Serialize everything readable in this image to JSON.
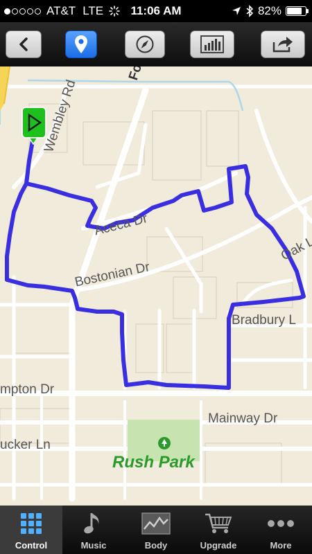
{
  "status_bar": {
    "carrier": "AT&T",
    "network": "LTE",
    "time": "11:06 AM",
    "battery": "82%",
    "battery_level": 0.82
  },
  "toolbar": {
    "buttons": [
      {
        "icon": "back-chevron-icon"
      },
      {
        "icon": "map-pin-icon",
        "active": true
      },
      {
        "icon": "compass-icon"
      },
      {
        "icon": "bar-chart-icon"
      },
      {
        "icon": "share-icon"
      }
    ]
  },
  "map": {
    "streets": {
      "fo": "Fo",
      "wembley": "Wembley Rd",
      "aceca": "Aceca Dr",
      "bostonian": "Bostonian Dr",
      "oak": "Oak L",
      "bradbury": "Bradbury L",
      "hampton": "mpton Dr",
      "mainway": "Mainway Dr",
      "tucker": "ucker Ln"
    },
    "park_name": "Rush Park",
    "route_color": "#3a2fe0",
    "start_marker_color": "#1dc01d"
  },
  "tabbar": {
    "active": "Control",
    "tabs": [
      {
        "label": "Control",
        "icon": "grid-icon"
      },
      {
        "label": "Music",
        "icon": "music-note-icon"
      },
      {
        "label": "Body",
        "icon": "body-chart-icon"
      },
      {
        "label": "Upgrade",
        "icon": "cart-icon"
      },
      {
        "label": "More",
        "icon": "more-dots-icon"
      }
    ]
  }
}
